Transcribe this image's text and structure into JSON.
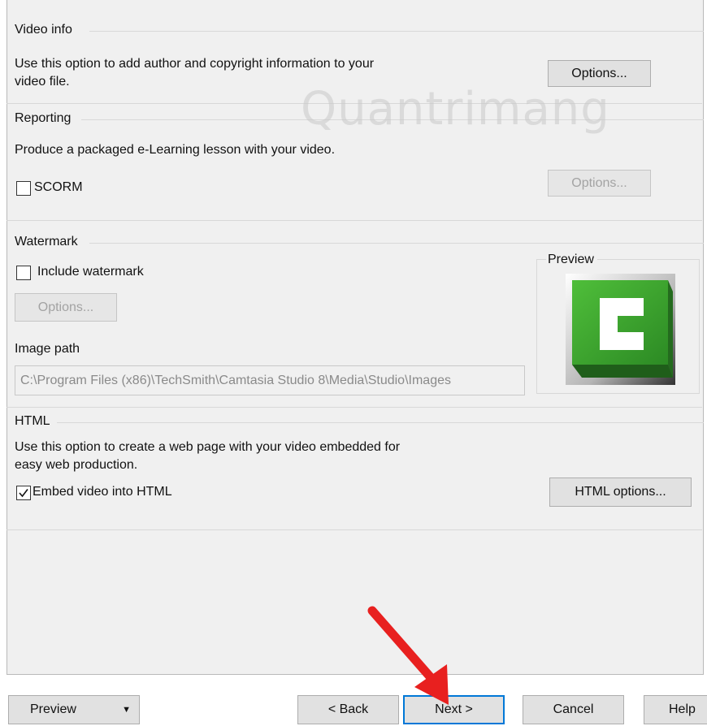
{
  "video_info": {
    "legend": "Video info",
    "description_line1": "Use this option to add author and copyright information to your",
    "description_line2": "video file.",
    "options_label": "Options..."
  },
  "reporting": {
    "legend": "Reporting",
    "description": "Produce a packaged e-Learning lesson with your video.",
    "scorm_label": "SCORM",
    "scorm_checked": false,
    "options_label": "Options..."
  },
  "watermark": {
    "legend": "Watermark",
    "include_label": "Include watermark",
    "include_checked": false,
    "options_label": "Options...",
    "image_path_label": "Image path",
    "image_path_value": "C:\\Program Files (x86)\\TechSmith\\Camtasia Studio 8\\Media\\Studio\\Images",
    "preview_legend": "Preview"
  },
  "html": {
    "legend": "HTML",
    "description_line1": "Use this option to create a web page with your video embedded for",
    "description_line2": "easy web production.",
    "embed_label": "Embed video into HTML",
    "embed_checked": true,
    "options_label": "HTML options..."
  },
  "footer": {
    "preview_label": "Preview",
    "back_label": "< Back",
    "next_label": "Next >",
    "cancel_label": "Cancel",
    "help_label": "Help"
  },
  "watermark_overlay": "Quantrimang",
  "colors": {
    "arrow": "#e8201f",
    "focus_border": "#0078d7",
    "logo_green": "#3aa12e"
  }
}
